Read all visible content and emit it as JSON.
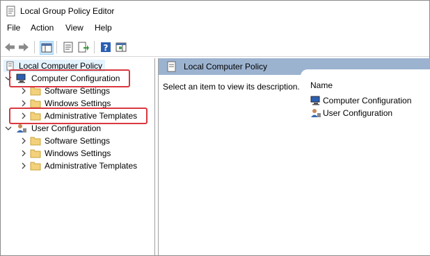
{
  "window": {
    "title": "Local Group Policy Editor"
  },
  "menu": [
    "File",
    "Action",
    "View",
    "Help"
  ],
  "toolbar": {
    "icons": [
      "back-arrow-icon",
      "forward-arrow-icon",
      "show-hide-tree-icon",
      "properties-icon",
      "export-list-icon",
      "help-icon",
      "show-hide-action-pane-icon"
    ]
  },
  "tree": {
    "root": "Local Computer Policy",
    "computer": {
      "label": "Computer Configuration",
      "children": [
        "Software Settings",
        "Windows Settings",
        "Administrative Templates"
      ]
    },
    "user": {
      "label": "User Configuration",
      "children": [
        "Software Settings",
        "Windows Settings",
        "Administrative Templates"
      ]
    }
  },
  "details": {
    "header": "Local Computer Policy",
    "description": "Select an item to view its description.",
    "column_name": "Name",
    "items": [
      "Computer Configuration",
      "User Configuration"
    ]
  },
  "colors": {
    "highlight": "#d9363e",
    "header_band": "#9cb3d0",
    "selected_bg": "#e5f3ff"
  }
}
